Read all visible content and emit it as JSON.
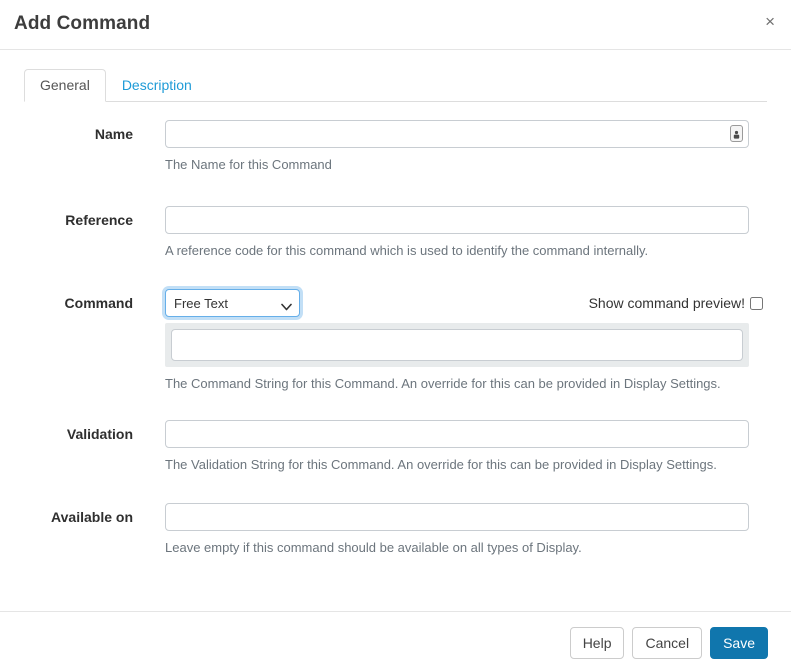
{
  "modal": {
    "title": "Add Command",
    "close_glyph": "×"
  },
  "tabs": {
    "general": "General",
    "description": "Description"
  },
  "form": {
    "name": {
      "label": "Name",
      "value": "",
      "help": "The Name for this Command"
    },
    "reference": {
      "label": "Reference",
      "value": "",
      "help": "A reference code for this command which is used to identify the command internally."
    },
    "command": {
      "label": "Command",
      "select_value": "Free Text",
      "checkbox_label": "Show command preview!",
      "checkbox_checked": false,
      "value": "",
      "help": "The Command String for this Command. An override for this can be provided in Display Settings."
    },
    "validation": {
      "label": "Validation",
      "value": "",
      "help": "The Validation String for this Command. An override for this can be provided in Display Settings."
    },
    "available_on": {
      "label": "Available on",
      "value": "",
      "help": "Leave empty if this command should be available on all types of Display."
    }
  },
  "footer": {
    "help_label": "Help",
    "cancel_label": "Cancel",
    "save_label": "Save"
  },
  "colors": {
    "link_blue": "#1e9bd7",
    "primary_button": "#1076ad",
    "focus_ring": "#66afe9",
    "panel_gray": "#e8ebec",
    "helper_gray": "#6c757d"
  }
}
